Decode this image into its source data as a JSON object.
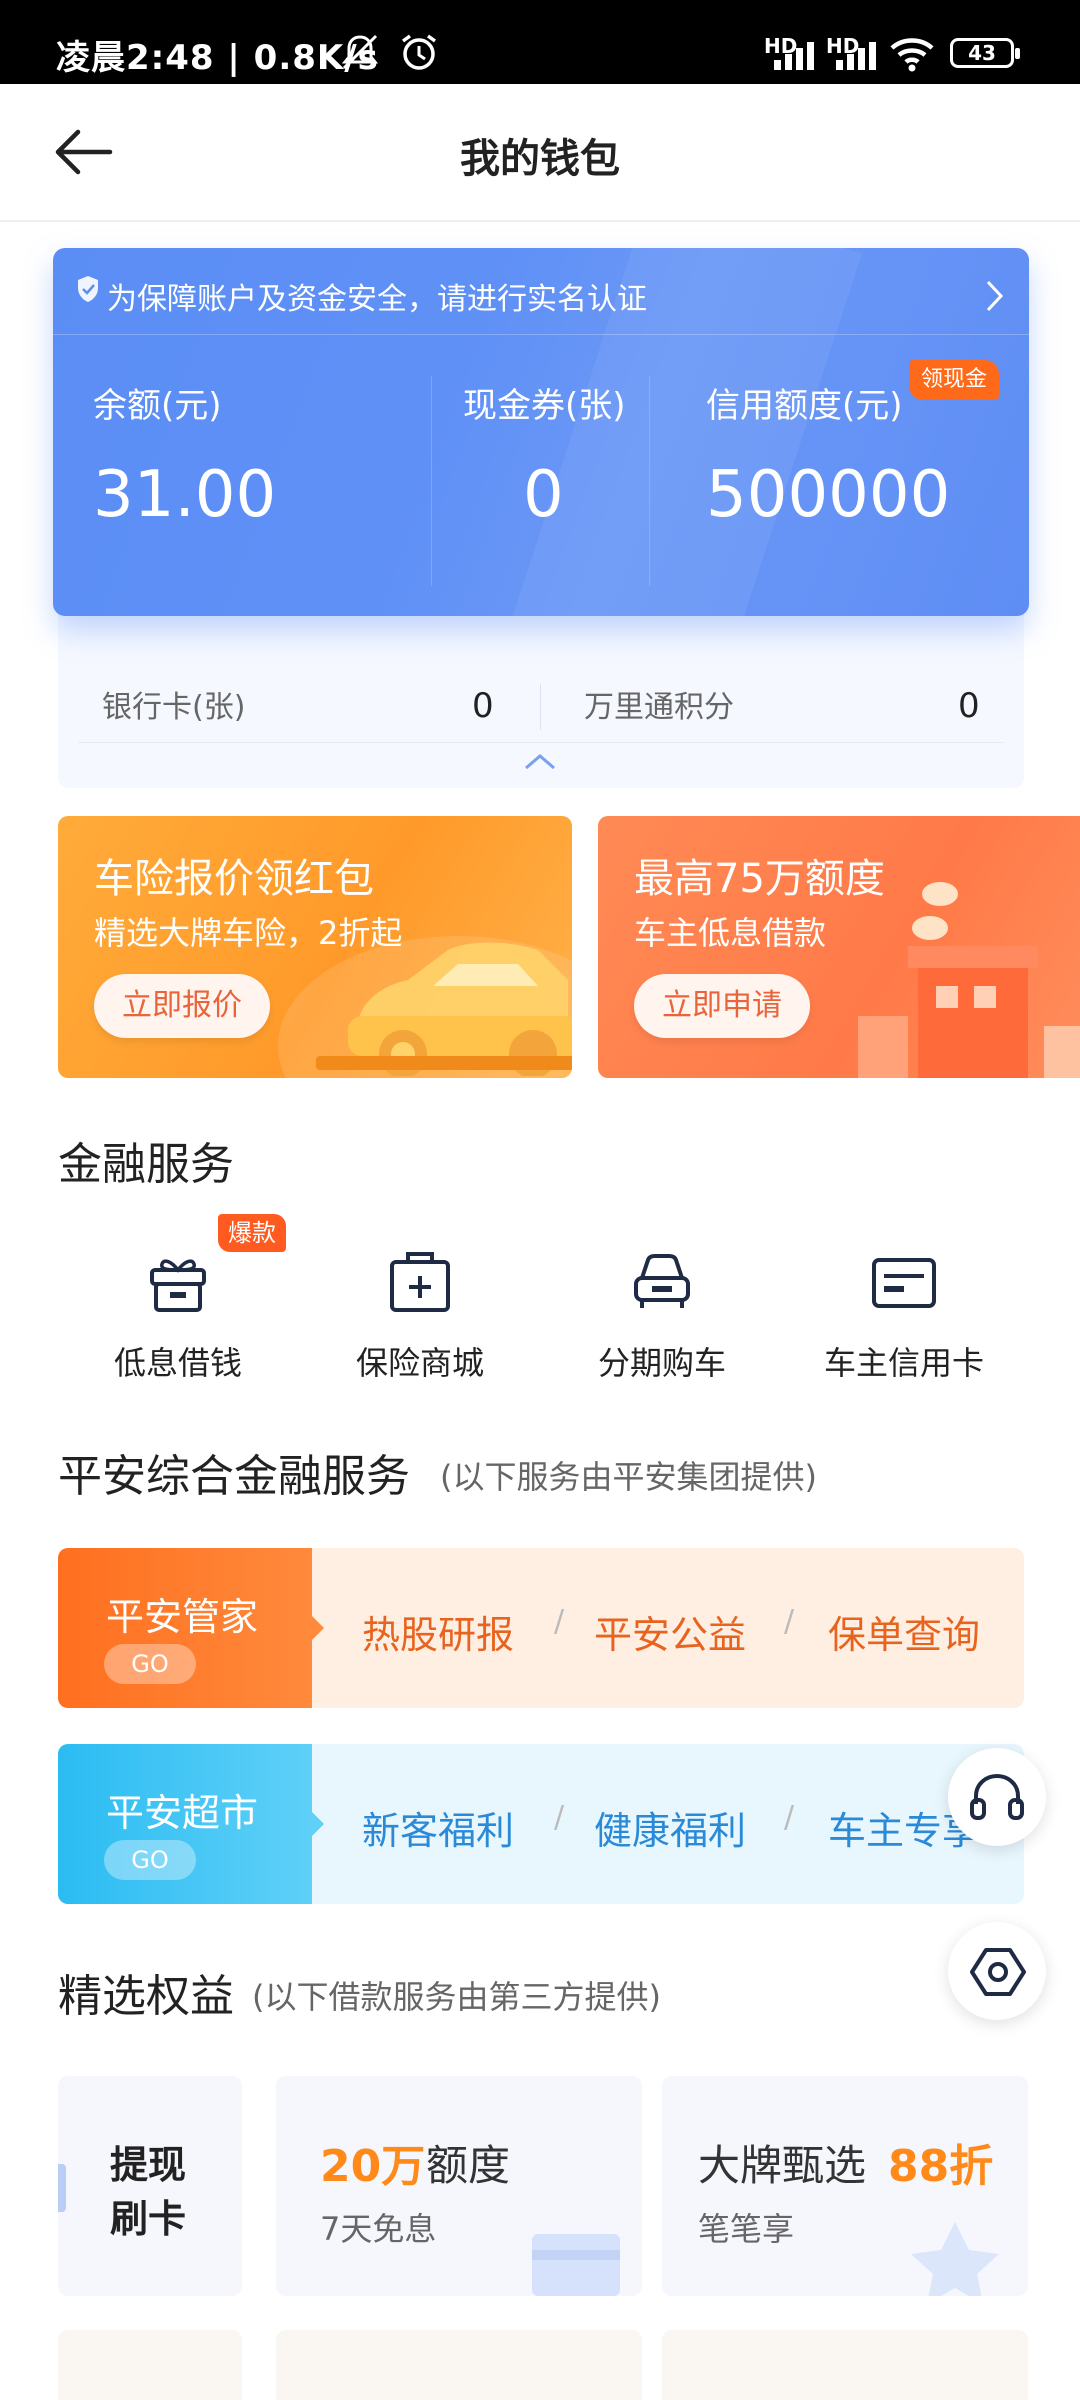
{
  "status_bar": {
    "time": "凌晨2:48 | 0.8K/s",
    "battery": "43",
    "hd1": "HD",
    "hd2": "HD"
  },
  "nav": {
    "title": "我的钱包"
  },
  "wallet": {
    "verify_notice": "为保障账户及资金安全，请进行实名认证",
    "balance_label": "余额(元)",
    "balance_value": "31.00",
    "coupon_label": "现金券(张)",
    "coupon_value": "0",
    "credit_label": "信用额度(元)",
    "credit_value": "500000",
    "cash_badge": "领现金",
    "bank_card_label": "银行卡(张)",
    "bank_card_value": "0",
    "points_label": "万里通积分",
    "points_value": "0"
  },
  "banners": [
    {
      "title": "车险报价领红包",
      "subtitle": "精选大牌车险，2折起",
      "button": "立即报价"
    },
    {
      "title": "最高75万额度",
      "subtitle": "车主低息借款",
      "button": "立即申请"
    }
  ],
  "financial_services": {
    "title": "金融服务",
    "hot_badge": "爆款",
    "items": [
      {
        "label": "低息借钱",
        "icon": "gift-box-icon"
      },
      {
        "label": "保险商城",
        "icon": "medical-kit-icon"
      },
      {
        "label": "分期购车",
        "icon": "car-icon"
      },
      {
        "label": "车主信用卡",
        "icon": "credit-card-icon"
      }
    ]
  },
  "pingan_services": {
    "title": "平安综合金融服务",
    "note": "(以下服务由平安集团提供)",
    "rows": [
      {
        "name": "平安管家",
        "go": "GO",
        "links": [
          "热股研报",
          "平安公益",
          "保单查询"
        ]
      },
      {
        "name": "平安超市",
        "go": "GO",
        "links": [
          "新客福利",
          "健康福利",
          "车主专享"
        ]
      }
    ]
  },
  "benefits": {
    "title": "精选权益",
    "note": "(以下借款服务由第三方提供)",
    "side_label_1": "提现",
    "side_label_2": "刷卡",
    "card1_highlight": "20万",
    "card1_title": "额度",
    "card1_sub": "7天免息",
    "card2_title": "大牌甄选",
    "card2_highlight": "88折",
    "card2_sub": "笔笔享"
  },
  "colors": {
    "wallet_blue": "#5b8ef5",
    "orange_accent": "#ff6a1a",
    "link_orange": "#e8641e",
    "link_blue": "#2a8ad8"
  }
}
